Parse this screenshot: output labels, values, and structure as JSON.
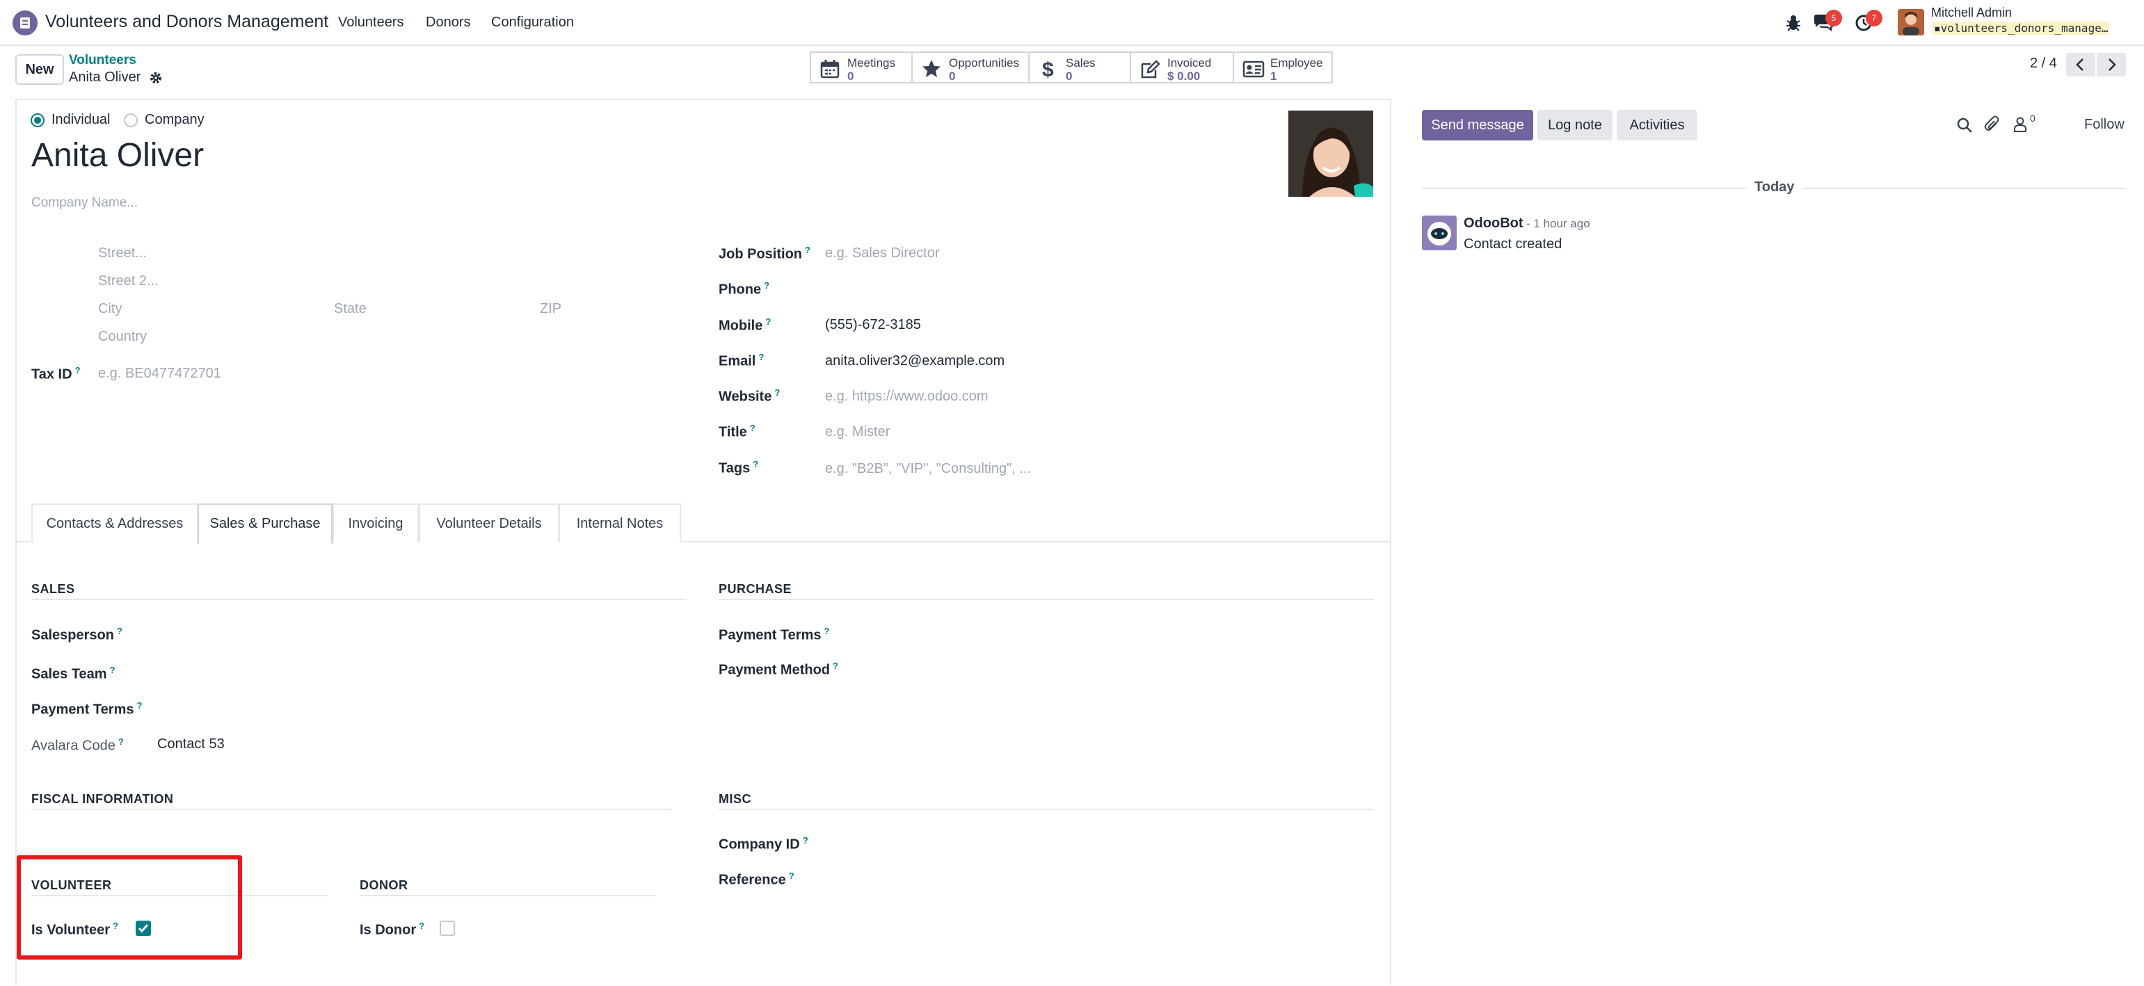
{
  "navbar": {
    "app_title": "Volunteers and Donors Management",
    "menus": [
      "Volunteers",
      "Donors",
      "Configuration"
    ],
    "messages_badge": "5",
    "activities_badge": "7",
    "user_name": "Mitchell Admin",
    "database": "volunteers_donors_manage…",
    "icons": [
      "app-icon",
      "bug-icon",
      "chat-icon",
      "clock-icon",
      "avatar"
    ]
  },
  "control": {
    "new_label": "New",
    "breadcrumb_parent": "Volunteers",
    "breadcrumb_current": "Anita Oliver",
    "pager": "2 / 4"
  },
  "smart_buttons": [
    {
      "label": "Meetings",
      "value": "0",
      "icon": "calendar-icon"
    },
    {
      "label": "Opportunities",
      "value": "0",
      "icon": "star-icon"
    },
    {
      "label": "Sales",
      "value": "0",
      "icon": "dollar-icon"
    },
    {
      "label": "Invoiced",
      "value": "$ 0.00",
      "icon": "invoice-icon"
    },
    {
      "label": "Employee",
      "value": "1",
      "icon": "id-card-icon"
    }
  ],
  "form": {
    "type_individual": "Individual",
    "type_company": "Company",
    "name": "Anita Oliver",
    "company_placeholder": "Company Name...",
    "street_placeholder": "Street...",
    "street2_placeholder": "Street 2...",
    "city_placeholder": "City",
    "state_placeholder": "State",
    "zip_placeholder": "ZIP",
    "country_placeholder": "Country",
    "tax_id_label": "Tax ID",
    "tax_id_placeholder": "e.g. BE0477472701",
    "job_position_label": "Job Position",
    "job_position_placeholder": "e.g. Sales Director",
    "phone_label": "Phone",
    "mobile_label": "Mobile",
    "mobile_value": "(555)-672-3185",
    "email_label": "Email",
    "email_value": "anita.oliver32@example.com",
    "website_label": "Website",
    "website_placeholder": "e.g. https://www.odoo.com",
    "title_label": "Title",
    "title_placeholder": "e.g. Mister",
    "tags_label": "Tags",
    "tags_placeholder": "e.g. \"B2B\", \"VIP\", \"Consulting\", ...",
    "help_mark": "?"
  },
  "tabs": [
    "Contacts & Addresses",
    "Sales & Purchase",
    "Invoicing",
    "Volunteer Details",
    "Internal Notes"
  ],
  "sales_purchase": {
    "sales_title": "SALES",
    "salesperson_label": "Salesperson",
    "sales_team_label": "Sales Team",
    "payment_terms_label": "Payment Terms",
    "avalara_label": "Avalara Code",
    "avalara_value": "Contact 53",
    "purchase_title": "PURCHASE",
    "purchase_payment_terms_label": "Payment Terms",
    "payment_method_label": "Payment Method",
    "fiscal_title": "FISCAL INFORMATION",
    "misc_title": "MISC",
    "company_id_label": "Company ID",
    "reference_label": "Reference",
    "volunteer_title": "VOLUNTEER",
    "is_volunteer_label": "Is Volunteer",
    "is_volunteer_checked": true,
    "donor_title": "DONOR",
    "is_donor_label": "Is Donor",
    "is_donor_checked": false
  },
  "chatter": {
    "send_message": "Send message",
    "log_note": "Log note",
    "activities": "Activities",
    "followers_count": "0",
    "follow": "Follow",
    "date_separator": "Today",
    "message_author": "OdooBot",
    "message_time": "- 1 hour ago",
    "message_body": "Contact created"
  },
  "colors": {
    "primary": "#71639e",
    "teal": "#017e84",
    "badge": "#e8403a",
    "highlight": "#e8171c"
  }
}
